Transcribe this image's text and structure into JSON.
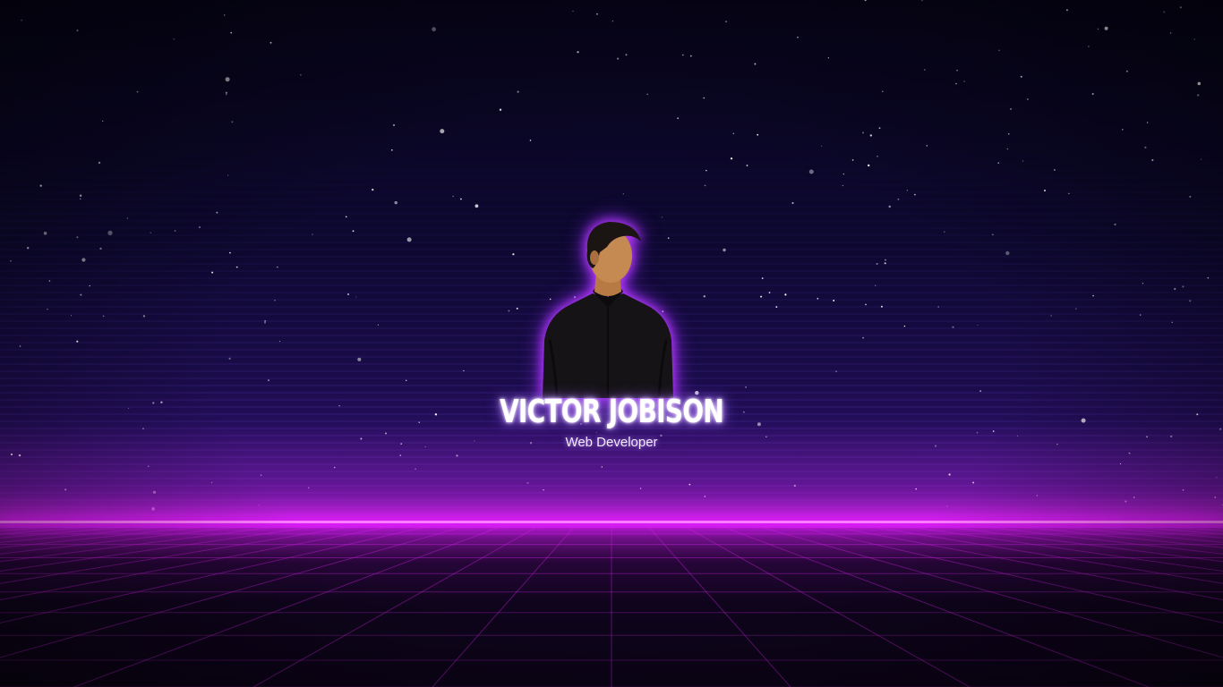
{
  "profile": {
    "name": "VICTOR JOBISON",
    "role": "Web Developer"
  },
  "colors": {
    "sky_top": "#07041a",
    "horizon_glow": "#e21bff",
    "grid_line": "#c020d8",
    "name_glow": "#c59bff"
  },
  "icons": {
    "avatar": "person-portrait"
  }
}
